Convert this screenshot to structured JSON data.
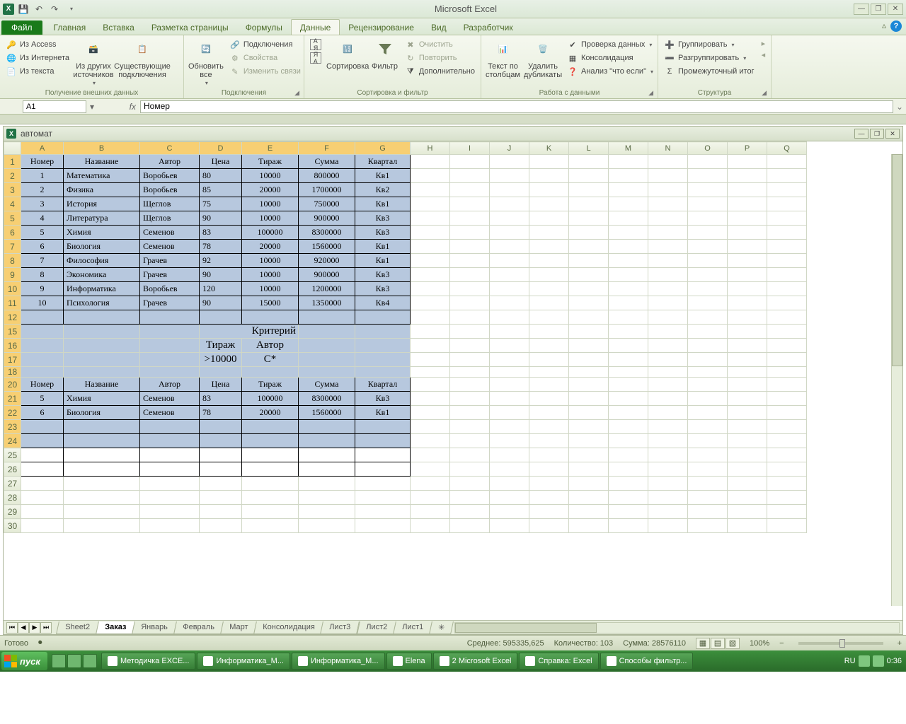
{
  "app_title": "Microsoft Excel",
  "qat": {
    "save": "💾",
    "undo": "↶",
    "redo": "↷"
  },
  "file_tab": "Файл",
  "tabs": [
    "Главная",
    "Вставка",
    "Разметка страницы",
    "Формулы",
    "Данные",
    "Рецензирование",
    "Вид",
    "Разработчик"
  ],
  "active_tab_index": 4,
  "ribbon": {
    "g1": {
      "label": "Получение внешних данных",
      "access": "Из Access",
      "web": "Из Интернета",
      "text": "Из текста",
      "other": "Из других источников",
      "existing": "Существующие подключения"
    },
    "g2": {
      "label": "Подключения",
      "refresh": "Обновить все",
      "conns": "Подключения",
      "props": "Свойства",
      "editlinks": "Изменить связи"
    },
    "g3": {
      "label": "Сортировка и фильтр",
      "az": "А↓Я",
      "za": "Я↓А",
      "sort": "Сортировка",
      "filter": "Фильтр",
      "clear": "Очистить",
      "reapply": "Повторить",
      "advanced": "Дополнительно"
    },
    "g4": {
      "label": "Работа с данными",
      "t2c": "Текст по столбцам",
      "dedup": "Удалить дубликаты",
      "validate": "Проверка данных",
      "consolidate": "Консолидация",
      "whatif": "Анализ \"что если\""
    },
    "g5": {
      "label": "Структура",
      "group": "Группировать",
      "ungroup": "Разгруппировать",
      "subtotal": "Промежуточный итог"
    }
  },
  "namebox": "A1",
  "formula": "Номер",
  "workbook_name": "автомат",
  "columns": [
    "A",
    "B",
    "C",
    "D",
    "E",
    "F",
    "G",
    "H",
    "I",
    "J",
    "K",
    "L",
    "M",
    "N",
    "O",
    "P",
    "Q"
  ],
  "sel_cols": [
    "A",
    "B",
    "C",
    "D",
    "E",
    "F",
    "G"
  ],
  "headers": [
    "Номер",
    "Название",
    "Автор",
    "Цена",
    "Тираж",
    "Сумма",
    "Квартал"
  ],
  "rows": [
    {
      "n": "1",
      "name": "Математика",
      "author": "Воробьев",
      "price": "80",
      "tir": "10000",
      "sum": "800000",
      "q": "Кв1"
    },
    {
      "n": "2",
      "name": "Физика",
      "author": "Воробьев",
      "price": "85",
      "tir": "20000",
      "sum": "1700000",
      "q": "Кв2"
    },
    {
      "n": "3",
      "name": "История",
      "author": "Щеглов",
      "price": "75",
      "tir": "10000",
      "sum": "750000",
      "q": "Кв1"
    },
    {
      "n": "4",
      "name": "Литература",
      "author": "Щеглов",
      "price": "90",
      "tir": "10000",
      "sum": "900000",
      "q": "Кв3"
    },
    {
      "n": "5",
      "name": "Химия",
      "author": "Семенов",
      "price": "83",
      "tir": "100000",
      "sum": "8300000",
      "q": "Кв3"
    },
    {
      "n": "6",
      "name": "Биология",
      "author": "Семенов",
      "price": "78",
      "tir": "20000",
      "sum": "1560000",
      "q": "Кв1"
    },
    {
      "n": "7",
      "name": "Философия",
      "author": "Грачев",
      "price": "92",
      "tir": "10000",
      "sum": "920000",
      "q": "Кв1"
    },
    {
      "n": "8",
      "name": "Экономика",
      "author": "Грачев",
      "price": "90",
      "tir": "10000",
      "sum": "900000",
      "q": "Кв3"
    },
    {
      "n": "9",
      "name": "Информатика",
      "author": "Воробьев",
      "price": "120",
      "tir": "10000",
      "sum": "1200000",
      "q": "Кв3"
    },
    {
      "n": "10",
      "name": "Психология",
      "author": "Грачев",
      "price": "90",
      "tir": "15000",
      "sum": "1350000",
      "q": "Кв4"
    }
  ],
  "criteria": {
    "title": "Критерий",
    "h1": "Тираж",
    "h2": "Автор",
    "v1": ">10000",
    "v2": "С*"
  },
  "result_rows": [
    {
      "n": "5",
      "name": "Химия",
      "author": "Семенов",
      "price": "83",
      "tir": "100000",
      "sum": "8300000",
      "q": "Кв3"
    },
    {
      "n": "6",
      "name": "Биология",
      "author": "Семенов",
      "price": "78",
      "tir": "20000",
      "sum": "1560000",
      "q": "Кв1"
    }
  ],
  "row_numbers_main": [
    1,
    2,
    3,
    4,
    5,
    6,
    7,
    8,
    9,
    10,
    11,
    12,
    15,
    16,
    17,
    18,
    20,
    21,
    22,
    23,
    24,
    25,
    26,
    27,
    28,
    29,
    30
  ],
  "sheet_tabs": [
    "Sheet2",
    "Заказ",
    "Январь",
    "Февраль",
    "Март",
    "Консолидация",
    "Лист3",
    "Лист2",
    "Лист1"
  ],
  "active_sheet_index": 1,
  "status": {
    "ready": "Готово",
    "avg": "Среднее: 595335,625",
    "count": "Количество: 103",
    "sum": "Сумма: 28576110",
    "zoom": "100%"
  },
  "taskbar": {
    "start": "пуск",
    "items": [
      "Методичка EXCE...",
      "Информатика_М...",
      "Информатика_М...",
      "Elena",
      "2 Microsoft Excel",
      "Справка: Excel",
      "Способы фильтр..."
    ],
    "lang": "RU",
    "time": "0:36"
  }
}
